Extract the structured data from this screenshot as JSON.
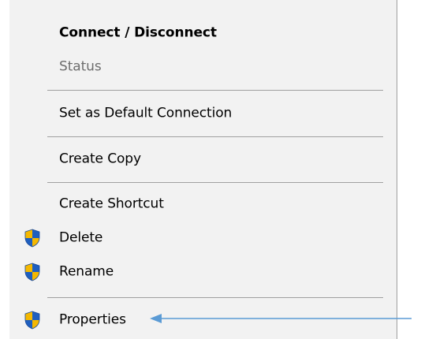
{
  "context_menu": {
    "items": [
      {
        "label": "Connect / Disconnect"
      },
      {
        "label": "Status"
      },
      {
        "label": "Set as Default Connection"
      },
      {
        "label": "Create Copy"
      },
      {
        "label": "Create Shortcut"
      },
      {
        "label": "Delete",
        "icon": "uac-shield-icon"
      },
      {
        "label": "Rename",
        "icon": "uac-shield-icon"
      },
      {
        "label": "Properties",
        "icon": "uac-shield-icon"
      }
    ]
  },
  "colors": {
    "menu_background": "#f2f2f2",
    "separator": "#a0a0a0",
    "disabled_text": "#6d6d6d",
    "shield_blue": "#1f5fbf",
    "shield_yellow": "#f5b800",
    "arrow": "#5b9bd5"
  }
}
